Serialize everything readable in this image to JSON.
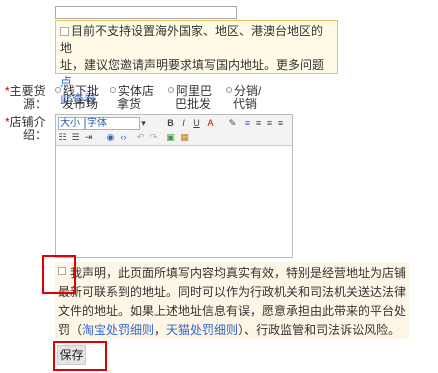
{
  "notice": {
    "line1": "目前不支持设置海外国家、地区、港澳台地区的地",
    "line2": "址，建议您邀请声明要求填写国内地址。更多问题",
    "link_a": "点",
    "link_b": "此查看"
  },
  "main_source": {
    "label_line1": "主要货",
    "label_line2": "源：",
    "options": [
      {
        "line1": "线下批",
        "line2": "发市场"
      },
      {
        "line1": "实体店",
        "line2": "拿货"
      },
      {
        "line1": "阿里巴",
        "line2": "巴批发"
      },
      {
        "line1": "分销/",
        "line2": "代销"
      }
    ]
  },
  "shop_intro": {
    "label_line1": "店铺介",
    "label_line2": "绍："
  },
  "editor": {
    "font_size_value": "大小",
    "font_family_value": "字体",
    "toolbar_glyphs": {
      "bold": "B",
      "italic": "I",
      "underline": "U",
      "color": "A",
      "undo": "↶",
      "redo": "↷"
    }
  },
  "declaration": {
    "line1": "我声明，此页面所填写内容均真实有效，特别是经营地址为店铺",
    "line2": "最新可联系到的地址。同时可以作为行政机关和司法机关送达法律",
    "line3": "文件的地址。如果上述地址信息有误，愿意承担由此带来的平台处",
    "line4_a": "罚（",
    "link_taobao": "淘宝处罚细则",
    "sep": "，",
    "link_tmall": "天猫处罚细则",
    "line4_b": "）、行政监管和司法诉讼风险。"
  },
  "save_label": "保存",
  "colors": {
    "required": "#cc0000",
    "link": "#3366cc",
    "highlight_box": "#e00000",
    "notice_bg": "#fffbe6",
    "notice_border": "#e7c25b",
    "decl_bg": "#fdf6e6"
  }
}
